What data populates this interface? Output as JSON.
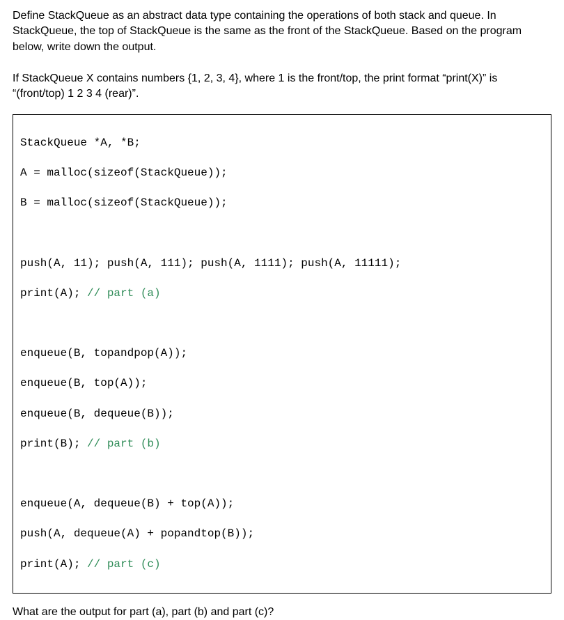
{
  "intro": {
    "p1": "Define StackQueue as an abstract data type containing the operations of both stack and queue. In StackQueue, the top of StackQueue is the same as the front of the StackQueue. Based on the program below, write down the output.",
    "p2": "If StackQueue X contains numbers {1, 2, 3, 4}, where 1 is the front/top, the print format “print(X)” is “(front/top) 1 2 3 4 (rear)”."
  },
  "code": {
    "l1": "StackQueue *A, *B;",
    "l2": "A = malloc(sizeof(StackQueue));",
    "l3": "B = malloc(sizeof(StackQueue));",
    "l4": "push(A, 11); push(A, 111); push(A, 1111); push(A, 11111);",
    "l5a": "print(A); ",
    "l5c": "// part (a)",
    "l6": "enqueue(B, topandpop(A));",
    "l7": "enqueue(B, top(A));",
    "l8": "enqueue(B, dequeue(B));",
    "l9a": "print(B); ",
    "l9c": "// part (b)",
    "l10": "enqueue(A, dequeue(B) + top(A));",
    "l11": "push(A, dequeue(A) + popandtop(B));",
    "l12a": "print(A); ",
    "l12c": "// part (c)"
  },
  "question": "What are the output for part (a), part (b) and part (c)?"
}
